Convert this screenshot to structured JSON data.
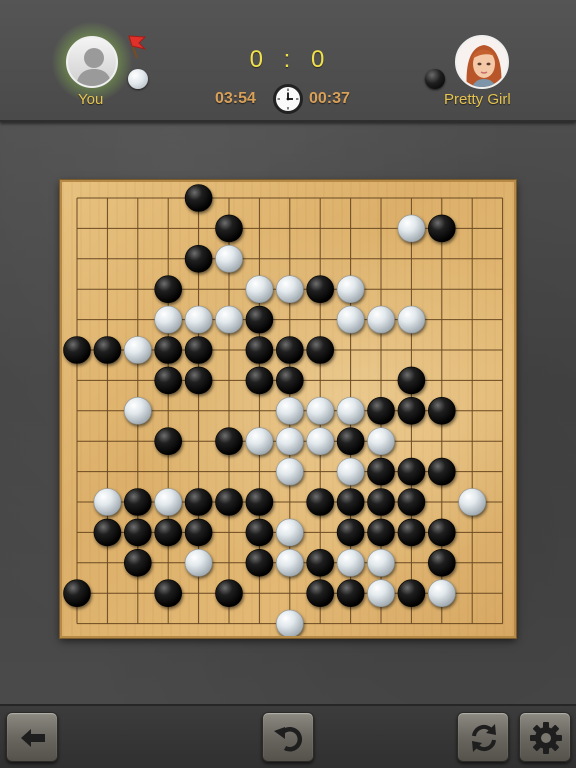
{
  "header": {
    "score_you": "0",
    "score_sep": ":",
    "score_opponent": "0",
    "timer_you": "03:54",
    "timer_opponent": "00:37",
    "players": {
      "you": {
        "name": "You",
        "stone": "white",
        "avatar_icon": "default-user-avatar-icon",
        "indicator_icon": "red-flag-icon"
      },
      "opponent": {
        "name": "Pretty Girl",
        "stone": "black",
        "avatar_icon": "girl-portrait-avatar-icon"
      }
    }
  },
  "board": {
    "size": 15,
    "stones": {
      "black": [
        [
          4,
          0
        ],
        [
          5,
          1
        ],
        [
          12,
          1
        ],
        [
          4,
          2
        ],
        [
          3,
          3
        ],
        [
          8,
          3
        ],
        [
          0,
          5
        ],
        [
          1,
          5
        ],
        [
          4,
          11
        ],
        [
          6,
          4
        ],
        [
          3,
          5
        ],
        [
          4,
          5
        ],
        [
          6,
          5
        ],
        [
          7,
          5
        ],
        [
          8,
          5
        ],
        [
          3,
          6
        ],
        [
          4,
          6
        ],
        [
          6,
          6
        ],
        [
          7,
          6
        ],
        [
          11,
          6
        ],
        [
          10,
          7
        ],
        [
          11,
          7
        ],
        [
          12,
          7
        ],
        [
          3,
          8
        ],
        [
          5,
          8
        ],
        [
          9,
          8
        ],
        [
          10,
          9
        ],
        [
          11,
          9
        ],
        [
          12,
          9
        ],
        [
          2,
          10
        ],
        [
          4,
          10
        ],
        [
          5,
          10
        ],
        [
          6,
          10
        ],
        [
          8,
          10
        ],
        [
          9,
          10
        ],
        [
          10,
          10
        ],
        [
          11,
          10
        ],
        [
          1,
          11
        ],
        [
          2,
          11
        ],
        [
          3,
          11
        ],
        [
          6,
          11
        ],
        [
          9,
          11
        ],
        [
          10,
          11
        ],
        [
          11,
          11
        ],
        [
          12,
          11
        ],
        [
          2,
          12
        ],
        [
          6,
          12
        ],
        [
          8,
          12
        ],
        [
          12,
          12
        ],
        [
          0,
          13
        ],
        [
          3,
          13
        ],
        [
          5,
          13
        ],
        [
          8,
          13
        ],
        [
          9,
          13
        ],
        [
          11,
          13
        ]
      ],
      "white": [
        [
          5,
          2
        ],
        [
          3,
          4
        ],
        [
          11,
          4
        ],
        [
          6,
          5
        ],
        [
          7,
          6
        ],
        [
          8,
          3
        ],
        [
          9,
          3
        ],
        [
          11,
          1
        ],
        [
          2,
          5
        ],
        [
          2,
          7
        ],
        [
          3,
          4
        ],
        [
          4,
          4
        ],
        [
          5,
          4
        ],
        [
          6,
          3
        ],
        [
          7,
          3
        ],
        [
          8,
          3
        ],
        [
          9,
          4
        ],
        [
          10,
          4
        ],
        [
          7,
          7
        ],
        [
          8,
          7
        ],
        [
          9,
          7
        ],
        [
          10,
          7
        ],
        [
          5,
          8
        ],
        [
          6,
          8
        ],
        [
          7,
          8
        ],
        [
          8,
          8
        ],
        [
          10,
          8
        ],
        [
          7,
          9
        ],
        [
          9,
          9
        ],
        [
          1,
          10
        ],
        [
          2,
          10
        ],
        [
          3,
          10
        ],
        [
          5,
          10
        ],
        [
          9,
          10
        ],
        [
          13,
          10
        ],
        [
          2,
          11
        ],
        [
          3,
          11
        ],
        [
          4,
          11
        ],
        [
          7,
          11
        ],
        [
          9,
          11
        ],
        [
          10,
          11
        ],
        [
          12,
          11
        ],
        [
          4,
          12
        ],
        [
          6,
          12
        ],
        [
          7,
          12
        ],
        [
          9,
          12
        ],
        [
          10,
          12
        ],
        [
          10,
          13
        ],
        [
          12,
          13
        ],
        [
          7,
          14
        ]
      ],
      "last_move": "black"
    }
  },
  "toolbar": {
    "back_icon": "back-arrow-icon",
    "undo_icon": "undo-icon",
    "restart_icon": "restart-icon",
    "settings_icon": "gear-icon"
  },
  "colors": {
    "score": "#f0e14a",
    "timer": "#d8a058",
    "name": "#e6c44f"
  }
}
